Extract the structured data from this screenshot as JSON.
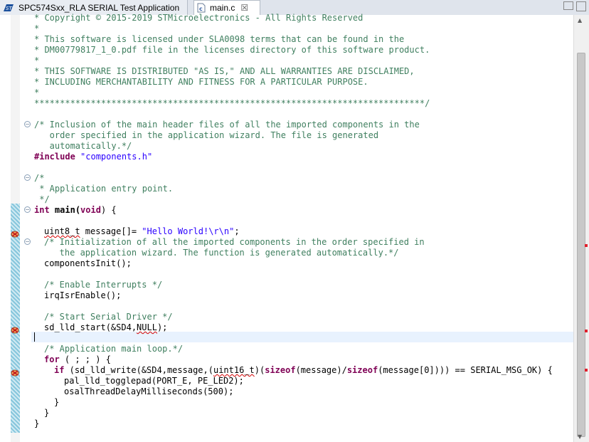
{
  "tabs": [
    {
      "label": "SPC574Sxx_RLA SERIAL Test Application",
      "icon": "st-logo-icon"
    },
    {
      "label": "main.c",
      "icon": "c-file-icon",
      "close": "☒"
    }
  ],
  "code": {
    "l1": "* Copyright © 2015-2019 STMicroelectronics - All Rights Reserved",
    "l2": "*",
    "l3": "* This software is licensed under SLA0098 terms that can be found in the",
    "l4": "* DM00779817_1_0.pdf file in the licenses directory of this software product.",
    "l5": "*",
    "l6": "* THIS SOFTWARE IS DISTRIBUTED \"AS IS,\" AND ALL WARRANTIES ARE DISCLAIMED,",
    "l7": "* INCLUDING MERCHANTABILITY AND FITNESS FOR A PARTICULAR PURPOSE.",
    "l8": "*",
    "l9": "****************************************************************************/",
    "l10": "/* Inclusion of the main header files of all the imported components in the",
    "l11": "   order specified in the application wizard. The file is generated",
    "l12": "   automatically.*/",
    "l13_kw": "#include",
    "l13_str": "\"components.h\"",
    "l14": "/*",
    "l15": " * Application entry point.",
    "l16": " */",
    "l17_kw1": "int",
    "l17_rest": "main(",
    "l17_kw2": "void",
    "l17_end": ") {",
    "l18_type": "uint8_t",
    "l18_mid": " message[]= ",
    "l18_str": "\"Hello World!\\r\\n\"",
    "l18_end": ";",
    "l19": "/* Initialization of all the imported components in the order specified in",
    "l20": "   the application wizard. The function is generated automatically.*/",
    "l21": "componentsInit();",
    "l22": "/* Enable Interrupts */",
    "l23": "irqIsrEnable();",
    "l24": "/* Start Serial Driver */",
    "l25_pre": "sd_lld_start(&SD4,",
    "l25_null": "NULL",
    "l25_end": ");",
    "l26": "/* Application main loop.*/",
    "l27_kw": "for",
    "l27_rest": " ( ; ; ) {",
    "l28_kw": "if",
    "l28_a": " (sd_lld_write(&SD4,message,(",
    "l28_type": "uint16_t",
    "l28_b": ")(",
    "l28_kw2": "sizeof",
    "l28_c": "(message)/",
    "l28_kw3": "sizeof",
    "l28_d": "(message[0]))) == SERIAL_MSG_OK) {",
    "l29": "pal_lld_togglepad(PORT_E, PE_LED2);",
    "l30": "osalThreadDelayMilliseconds(500);",
    "l31": "}",
    "l32": "}",
    "l33": "}"
  },
  "colors": {
    "comment": "#3f7f5f",
    "keyword": "#7f0055",
    "string": "#2a00ff",
    "error": "#d40000"
  }
}
